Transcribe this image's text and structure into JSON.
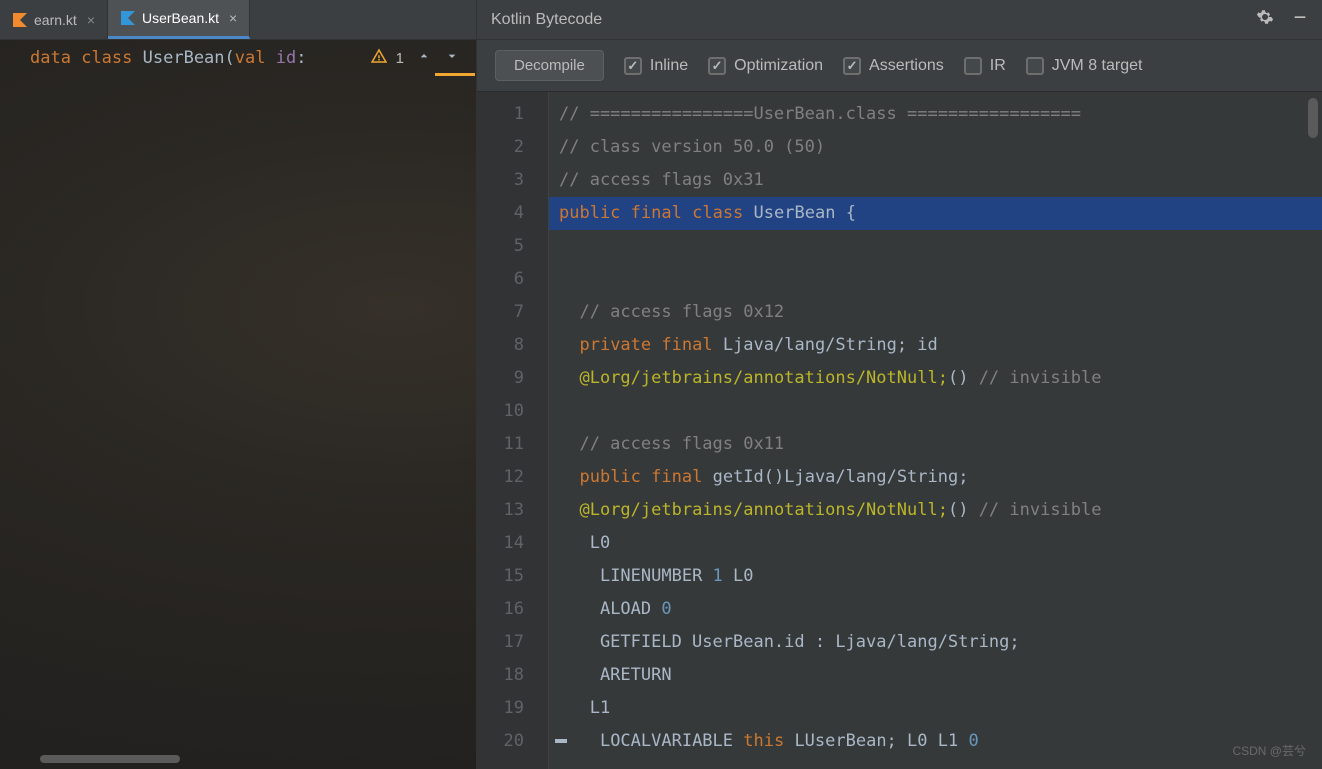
{
  "tabs": [
    {
      "label": "earn.kt",
      "active": false,
      "iconColor": "#f28b2f"
    },
    {
      "label": "UserBean.kt",
      "active": true,
      "iconColor": "#3296d8"
    }
  ],
  "editor": {
    "tokens": {
      "kw_data": "data",
      "kw_class": "class",
      "name": "UserBean",
      "lparen": "(",
      "kw_val": "val",
      "field": "id",
      "colon": ":"
    },
    "warningCount": "1"
  },
  "toolWindow": {
    "title": "Kotlin Bytecode",
    "decompileLabel": "Decompile",
    "options": [
      {
        "label": "Inline",
        "checked": true
      },
      {
        "label": "Optimization",
        "checked": true
      },
      {
        "label": "Assertions",
        "checked": true
      },
      {
        "label": "IR",
        "checked": false
      },
      {
        "label": "JVM 8 target",
        "checked": false
      }
    ]
  },
  "bytecode": {
    "highlightedLine": 4,
    "lines": [
      {
        "n": 1,
        "t": "comment",
        "text": "// ================UserBean.class ================="
      },
      {
        "n": 2,
        "t": "comment",
        "text": "// class version 50.0 (50)"
      },
      {
        "n": 3,
        "t": "comment",
        "text": "// access flags 0x31"
      },
      {
        "n": 4,
        "t": "decl",
        "parts": [
          [
            "kw",
            "public"
          ],
          [
            "sp",
            " "
          ],
          [
            "kw",
            "final"
          ],
          [
            "sp",
            " "
          ],
          [
            "kw",
            "class"
          ],
          [
            "sp",
            " "
          ],
          [
            "id",
            "UserBean"
          ],
          [
            "sp",
            " "
          ],
          [
            "id",
            "{"
          ]
        ]
      },
      {
        "n": 5,
        "t": "blank",
        "text": ""
      },
      {
        "n": 6,
        "t": "blank",
        "text": ""
      },
      {
        "n": 7,
        "t": "comment",
        "text": "  // access flags 0x12"
      },
      {
        "n": 8,
        "t": "decl",
        "parts": [
          [
            "sp",
            "  "
          ],
          [
            "kw",
            "private"
          ],
          [
            "sp",
            " "
          ],
          [
            "kw",
            "final"
          ],
          [
            "sp",
            " "
          ],
          [
            "id",
            "Ljava/lang/String; id"
          ]
        ]
      },
      {
        "n": 9,
        "t": "ann",
        "parts": [
          [
            "sp",
            "  "
          ],
          [
            "ann",
            "@Lorg/jetbrains/annotations/NotNull;"
          ],
          [
            "id",
            "()"
          ],
          [
            "sp",
            " "
          ],
          [
            "cm",
            "// invisible"
          ]
        ]
      },
      {
        "n": 10,
        "t": "blank",
        "text": ""
      },
      {
        "n": 11,
        "t": "comment",
        "text": "  // access flags 0x11"
      },
      {
        "n": 12,
        "t": "decl",
        "parts": [
          [
            "sp",
            "  "
          ],
          [
            "kw",
            "public"
          ],
          [
            "sp",
            " "
          ],
          [
            "kw",
            "final"
          ],
          [
            "sp",
            " "
          ],
          [
            "id",
            "getId()Ljava/lang/String;"
          ]
        ]
      },
      {
        "n": 13,
        "t": "ann",
        "parts": [
          [
            "sp",
            "  "
          ],
          [
            "ann",
            "@Lorg/jetbrains/annotations/NotNull;"
          ],
          [
            "id",
            "()"
          ],
          [
            "sp",
            " "
          ],
          [
            "cm",
            "// invisible"
          ]
        ]
      },
      {
        "n": 14,
        "t": "plain",
        "text": "   L0"
      },
      {
        "n": 15,
        "t": "instr",
        "parts": [
          [
            "sp",
            "    "
          ],
          [
            "id",
            "LINENUMBER "
          ],
          [
            "num",
            "1"
          ],
          [
            "id",
            " L0"
          ]
        ]
      },
      {
        "n": 16,
        "t": "instr",
        "parts": [
          [
            "sp",
            "    "
          ],
          [
            "id",
            "ALOAD "
          ],
          [
            "num",
            "0"
          ]
        ]
      },
      {
        "n": 17,
        "t": "plain",
        "text": "    GETFIELD UserBean.id : Ljava/lang/String;"
      },
      {
        "n": 18,
        "t": "plain",
        "text": "    ARETURN"
      },
      {
        "n": 19,
        "t": "plain",
        "text": "   L1"
      },
      {
        "n": 20,
        "t": "instr",
        "parts": [
          [
            "sp",
            "    "
          ],
          [
            "id",
            "LOCALVARIABLE "
          ],
          [
            "kw",
            "this"
          ],
          [
            "id",
            " LUserBean; L0 L1 "
          ],
          [
            "num",
            "0"
          ]
        ]
      }
    ]
  },
  "watermark": "CSDN @芸兮"
}
